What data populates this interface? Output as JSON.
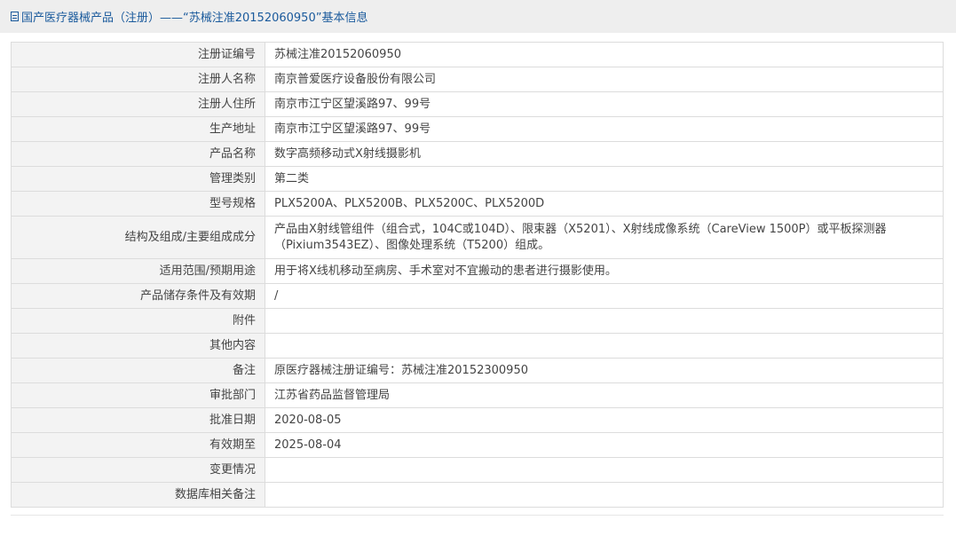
{
  "header": {
    "title": "国产医疗器械产品（注册）——“苏械注准20152060950”基本信息"
  },
  "rows": [
    {
      "label": "注册证编号",
      "value": "苏械注准20152060950"
    },
    {
      "label": "注册人名称",
      "value": "南京普爱医疗设备股份有限公司"
    },
    {
      "label": "注册人住所",
      "value": "南京市江宁区望溪路97、99号"
    },
    {
      "label": "生产地址",
      "value": "南京市江宁区望溪路97、99号"
    },
    {
      "label": "产品名称",
      "value": "数字高频移动式X射线摄影机"
    },
    {
      "label": "管理类别",
      "value": "第二类"
    },
    {
      "label": "型号规格",
      "value": "PLX5200A、PLX5200B、PLX5200C、PLX5200D"
    },
    {
      "label": "结构及组成/主要组成成分",
      "value": "产品由X射线管组件（组合式，104C或104D）、限束器（X5201）、X射线成像系统（CareView 1500P）或平板探测器（Pixium3543EZ）、图像处理系统（T5200）组成。"
    },
    {
      "label": "适用范围/预期用途",
      "value": "用于将X线机移动至病房、手术室对不宜搬动的患者进行摄影使用。"
    },
    {
      "label": "产品储存条件及有效期",
      "value": "/"
    },
    {
      "label": "附件",
      "value": ""
    },
    {
      "label": "其他内容",
      "value": ""
    },
    {
      "label": "备注",
      "value": "原医疗器械注册证编号：苏械注准20152300950"
    },
    {
      "label": "审批部门",
      "value": "江苏省药品监督管理局"
    },
    {
      "label": "批准日期",
      "value": "2020-08-05"
    },
    {
      "label": "有效期至",
      "value": "2025-08-04"
    },
    {
      "label": "变更情况",
      "value": ""
    },
    {
      "label": "数据库相关备注",
      "value": ""
    }
  ]
}
